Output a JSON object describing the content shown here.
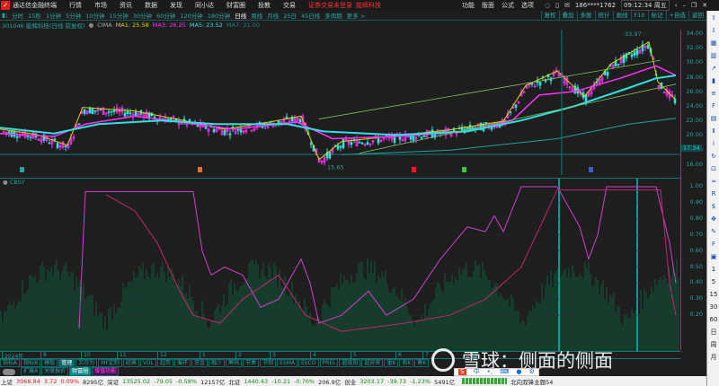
{
  "menubar": {
    "app_title": "通达信金融终端",
    "items": [
      "行情",
      "市场",
      "资讯",
      "数据",
      "发现",
      "同小达",
      "财富圈",
      "投教",
      "交易"
    ],
    "notice": "证券交易未登录",
    "stock_tag": "能辉科技",
    "right_items": [
      "功能",
      "版面",
      "公式",
      "选项"
    ],
    "user": "186****1762",
    "clock": "09:12:34 周五"
  },
  "periods": [
    "分时",
    "15秒",
    "1分钟",
    "5分钟",
    "10分钟",
    "15分钟",
    "30分钟",
    "60分钟",
    "120分钟",
    "180分钟",
    "日线",
    "周线",
    "月线",
    "25日",
    "45日线",
    "多周期",
    "更多 >"
  ],
  "active_period": "日线",
  "right_tools": [
    "复权",
    "叠加",
    "多股",
    "统计",
    "画线",
    "F10",
    "标记",
    "+自选",
    "返回"
  ],
  "info": {
    "stock": "301046 能辉科技(日线 前复权)",
    "indicator": "CIMA",
    "ma1": "MA1: 25.58",
    "ma3": "MA3: 26.25",
    "ma5": "MA5: 23.52",
    "ma7": "MA7: 21.00"
  },
  "colors": {
    "ma1": "#e0d000",
    "ma3": "#ff30ff",
    "ma5": "#30e0e0",
    "ma7": "#20a0a0",
    "up": "#e02020",
    "down": "#109010"
  },
  "price_axis": [
    "34.00",
    "32.00",
    "30.00",
    "28.00",
    "26.00",
    "24.00",
    "22.00",
    "20.00",
    "18.00",
    "16.00"
  ],
  "current_price_label": "17.34",
  "annotations": {
    "high": "33.97",
    "low": "15.65"
  },
  "indicator": {
    "name": "CBSY",
    "axis": [
      "1.00",
      "0.90",
      "0.80",
      "0.70",
      "0.60",
      "0.50",
      "0.40",
      "0.30",
      "0.20"
    ]
  },
  "dates": [
    "2024年",
    "8",
    "10",
    "11",
    "12",
    "1",
    "2",
    "3",
    "4",
    "5",
    "6",
    "7",
    "8"
  ],
  "tabs_row1": [
    "指标A",
    "指标B",
    "模板",
    "管理",
    "另存为",
    "MF定制",
    "经典",
    "VOL",
    "超势",
    "循环",
    "资金",
    "融少",
    "筹码",
    "节奏",
    "节制",
    "ESMA",
    "ESCO",
    "PREL",
    "超级阳",
    "超异夹",
    "量K",
    "卖K",
    "筹K"
  ],
  "tabs_row1_active": "管理",
  "tabs_row2": [
    "扩展A",
    "关联报价",
    "财富圈",
    "增值功能"
  ],
  "status": {
    "sh_label": "上证",
    "sh": "3968.84",
    "sh_chg": "3.72",
    "sh_pct": "0.09%",
    "sh_amt": "8295亿",
    "sz_label": "深证",
    "sz": "13525.02",
    "sz_chg": "-79.05",
    "sz_pct": "-0.58%",
    "sz_amt": "12157亿",
    "bz_label": "北证",
    "bz": "1440.43",
    "bz_chg": "-10.21",
    "bz_pct": "-0.70%",
    "bz_amt": "206.9亿",
    "cy_label": "创业",
    "cy": "3203.17",
    "cy_chg": "-39.73",
    "cy_pct": "-1.23%",
    "cy_amt": "5491亿",
    "news": "北向双锋主题54"
  },
  "sidebar_periods": [
    "1",
    "5",
    "15",
    "30",
    "60",
    "日",
    "周",
    "月"
  ],
  "watermark": "雪球：侧面的侧面",
  "ime": [
    "中"
  ]
}
